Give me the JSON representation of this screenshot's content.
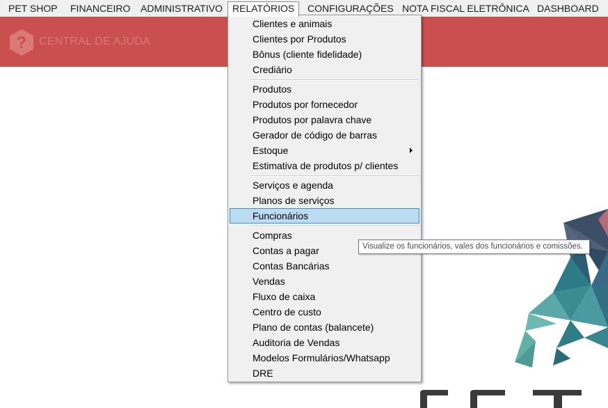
{
  "menubar": {
    "items": [
      {
        "label": "PET SHOP"
      },
      {
        "label": "FINANCEIRO"
      },
      {
        "label": "ADMINISTRATIVO"
      },
      {
        "label": "RELATÓRIOS"
      },
      {
        "label": "CONFIGURAÇÕES"
      },
      {
        "label": "NOTA FISCAL ELETRÔNICA"
      },
      {
        "label": "DASHBOARD"
      }
    ],
    "active": "RELATÓRIOS"
  },
  "header": {
    "help_label": "CENTRAL DE AJUDA",
    "background_color": "#c9504e"
  },
  "dropdown": {
    "items": [
      {
        "label": "Clientes e animais"
      },
      {
        "label": "Clientes por Produtos"
      },
      {
        "label": "Bônus (cliente fidelidade)"
      },
      {
        "label": "Crediário"
      },
      {
        "label": "Produtos"
      },
      {
        "label": "Produtos por fornecedor"
      },
      {
        "label": "Produtos por palavra chave"
      },
      {
        "label": "Gerador de código de barras"
      },
      {
        "label": "Estoque",
        "has_submenu": true
      },
      {
        "label": "Estimativa de produtos p/ clientes"
      },
      {
        "label": "Serviços e agenda"
      },
      {
        "label": "Planos de serviços"
      },
      {
        "label": "Funcionários",
        "highlighted": true
      },
      {
        "label": "Compras"
      },
      {
        "label": "Contas a pagar"
      },
      {
        "label": "Contas Bancárias"
      },
      {
        "label": "Vendas"
      },
      {
        "label": "Fluxo de caixa"
      },
      {
        "label": "Centro de custo"
      },
      {
        "label": "Plano de contas (balancete)"
      },
      {
        "label": "Auditoria de Vendas"
      },
      {
        "label": "Modelos Formulários/Whatsapp"
      },
      {
        "label": "DRE"
      }
    ],
    "highlight_color": "#bcdcf4"
  },
  "tooltip": {
    "text": "Visualize os funcionários, vales dos funcionários e comissões."
  }
}
